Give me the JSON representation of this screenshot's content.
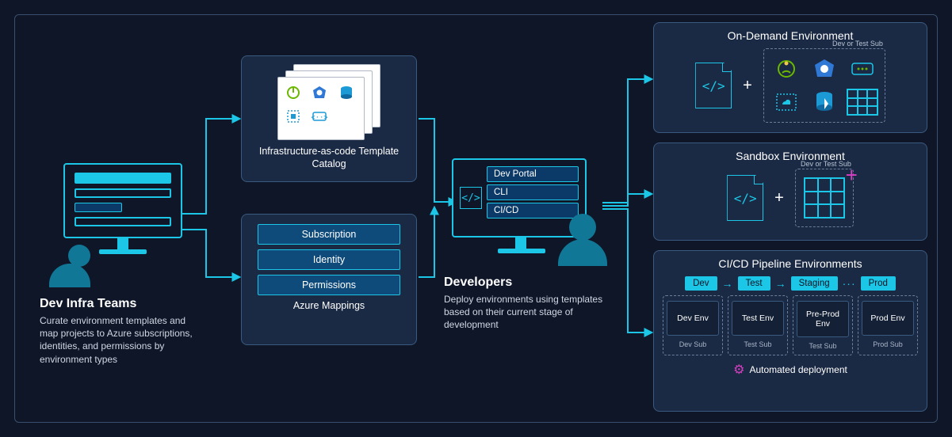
{
  "dev_infra": {
    "title": "Dev Infra Teams",
    "desc": "Curate environment templates and map projects to Azure subscriptions, identities, and permissions by environment types"
  },
  "iac": {
    "caption": "Infrastructure-as-code Template Catalog"
  },
  "azure_mappings": {
    "rows": [
      "Subscription",
      "Identity",
      "Permissions"
    ],
    "caption": "Azure Mappings"
  },
  "developers": {
    "title": "Developers",
    "desc": "Deploy environments using templates based on their current stage of development",
    "screen_rows": [
      "Dev Portal",
      "CLI",
      "CI/CD"
    ]
  },
  "on_demand": {
    "title": "On-Demand Environment",
    "sub_caption": "Dev or Test Sub"
  },
  "sandbox": {
    "title": "Sandbox Environment",
    "sub_caption": "Dev or Test Sub"
  },
  "cicd": {
    "title": "CI/CD Pipeline Environments",
    "stages": [
      "Dev",
      "Test",
      "Staging",
      "Prod"
    ],
    "envs": [
      {
        "name": "Dev Env",
        "sub": "Dev Sub"
      },
      {
        "name": "Test Env",
        "sub": "Test Sub"
      },
      {
        "name": "Pre-Prod Env",
        "sub": "Test Sub"
      },
      {
        "name": "Prod Env",
        "sub": "Prod Sub"
      }
    ],
    "automated": "Automated deployment"
  },
  "plus": "+",
  "code_glyph": "</>"
}
